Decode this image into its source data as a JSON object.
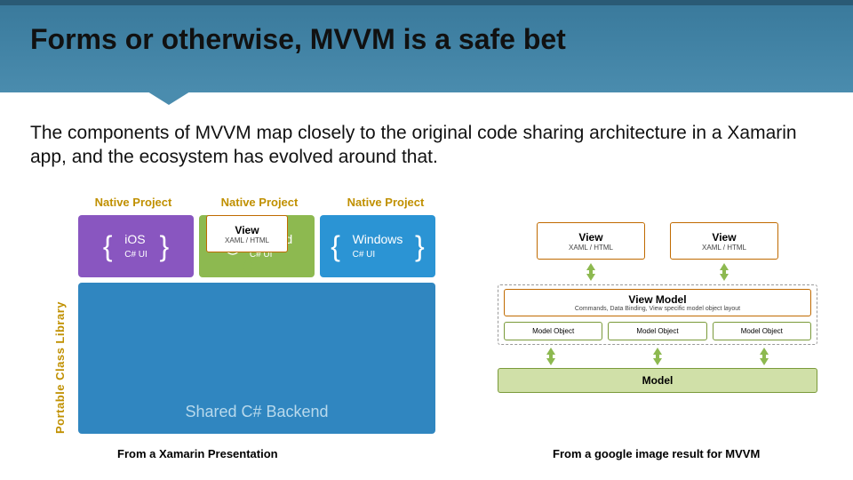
{
  "title": "Forms or otherwise, MVVM is a safe bet",
  "subtitle": "The components of MVVM map closely to the original code sharing architecture in a Xamarin app, and the ecosystem has evolved around that.",
  "left": {
    "np": "Native Project",
    "pcl": "Portable Class Library",
    "ios_l1": "iOS",
    "ios_l2": "C# UI",
    "android_l1": "Android",
    "android_l2": "C# UI",
    "windows_l1": "Windows",
    "windows_l2": "C# UI",
    "shared": "Shared C# Backend",
    "caption": "From a Xamarin Presentation"
  },
  "overlay": {
    "view": "View",
    "sub": "XAML / HTML"
  },
  "right": {
    "view": "View",
    "view_sub": "XAML / HTML",
    "vm": "View Model",
    "vm_sub": "Commands, Data Binding, View specific model object layout",
    "mo": "Model Object",
    "model": "Model",
    "caption": "From a google image result for MVVM"
  }
}
